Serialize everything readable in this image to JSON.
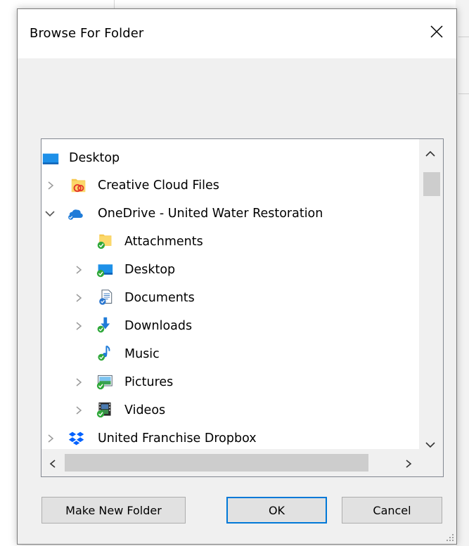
{
  "dialog": {
    "title": "Browse For Folder",
    "close_icon": "close-icon"
  },
  "tree": {
    "items": [
      {
        "label": "Desktop",
        "icon": "desktop-icon",
        "expander": "none"
      },
      {
        "label": "Creative Cloud Files",
        "icon": "creative-cloud-folder-icon",
        "expander": "collapsed"
      },
      {
        "label": "OneDrive - United Water Restoration",
        "icon": "onedrive-icon",
        "expander": "expanded"
      },
      {
        "label": "Attachments",
        "icon": "folder-synced-icon",
        "expander": "none"
      },
      {
        "label": "Desktop",
        "icon": "desktop-synced-icon",
        "expander": "collapsed"
      },
      {
        "label": "Documents",
        "icon": "documents-synced-icon",
        "expander": "collapsed"
      },
      {
        "label": "Downloads",
        "icon": "downloads-synced-icon",
        "expander": "collapsed"
      },
      {
        "label": "Music",
        "icon": "music-synced-icon",
        "expander": "none"
      },
      {
        "label": "Pictures",
        "icon": "pictures-synced-icon",
        "expander": "collapsed"
      },
      {
        "label": "Videos",
        "icon": "videos-synced-icon",
        "expander": "collapsed"
      },
      {
        "label": "United Franchise Dropbox",
        "icon": "dropbox-icon",
        "expander": "collapsed"
      }
    ]
  },
  "buttons": {
    "make_new_folder": "Make New Folder",
    "ok": "OK",
    "cancel": "Cancel"
  },
  "colors": {
    "accent": "#0078d7",
    "sync_green": "#2fa83a",
    "folder_yellow": "#f6c850"
  }
}
